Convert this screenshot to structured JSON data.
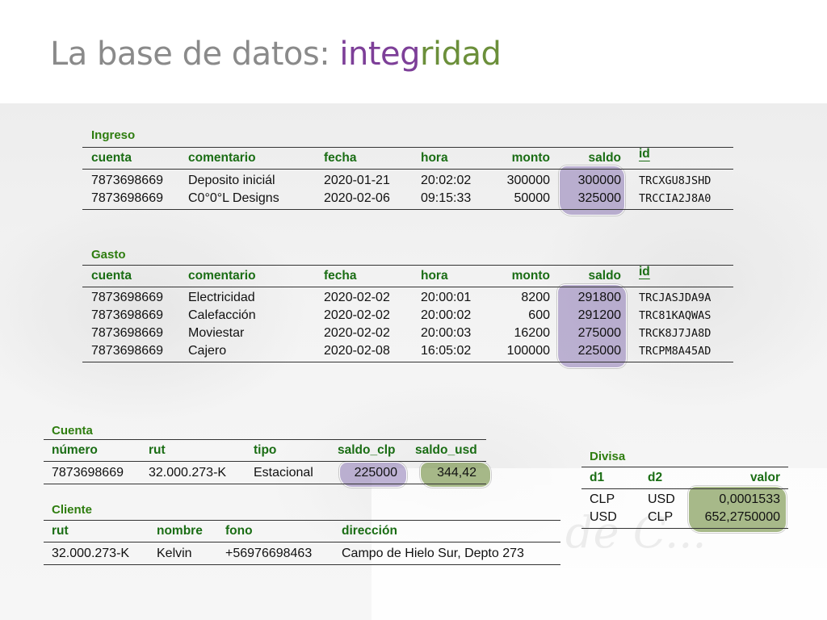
{
  "title": {
    "part1": "La base de datos: ",
    "part2": "integ",
    "part3": "ridad"
  },
  "ingreso": {
    "caption": "Ingreso",
    "headers": [
      "cuenta",
      "comentario",
      "fecha",
      "hora",
      "monto",
      "saldo",
      "id"
    ],
    "rows": [
      [
        "7873698669",
        "Deposito iniciál",
        "2020-01-21",
        "20:02:02",
        "300000",
        "300000",
        "TRCXGU8JSHD"
      ],
      [
        "7873698669",
        "C0°0°L Designs",
        "2020-02-06",
        "09:15:33",
        "50000",
        "325000",
        "TRCCIA2J8A0"
      ]
    ]
  },
  "gasto": {
    "caption": "Gasto",
    "headers": [
      "cuenta",
      "comentario",
      "fecha",
      "hora",
      "monto",
      "saldo",
      "id"
    ],
    "rows": [
      [
        "7873698669",
        "Electricidad",
        "2020-02-02",
        "20:00:01",
        "8200",
        "291800",
        "TRCJASJDA9A"
      ],
      [
        "7873698669",
        "Calefacción",
        "2020-02-02",
        "20:00:02",
        "600",
        "291200",
        "TRC81KAQWAS"
      ],
      [
        "7873698669",
        "Moviestar",
        "2020-02-02",
        "20:00:03",
        "16200",
        "275000",
        "TRCK8J7JA8D"
      ],
      [
        "7873698669",
        "Cajero",
        "2020-02-08",
        "16:05:02",
        "100000",
        "225000",
        "TRCPM8A45AD"
      ]
    ]
  },
  "cuenta": {
    "caption": "Cuenta",
    "headers": [
      "número",
      "rut",
      "tipo",
      "saldo_clp",
      "saldo_usd"
    ],
    "rows": [
      [
        "7873698669",
        "32.000.273-K",
        "Estacional",
        "225000",
        "344,42"
      ]
    ]
  },
  "cliente": {
    "caption": "Cliente",
    "headers": [
      "rut",
      "nombre",
      "fono",
      "dirección"
    ],
    "rows": [
      [
        "32.000.273-K",
        "Kelvin",
        "+56976698463",
        "Campo de Hielo Sur, Depto 273"
      ]
    ]
  },
  "divisa": {
    "caption": "Divisa",
    "headers": [
      "d1",
      "d2",
      "valor"
    ],
    "rows": [
      [
        "CLP",
        "USD",
        "0,0001533"
      ],
      [
        "USD",
        "CLP",
        "652,2750000"
      ]
    ]
  },
  "highlight_colors": {
    "purple": "#8c78b4",
    "green": "#6e8c3c"
  }
}
